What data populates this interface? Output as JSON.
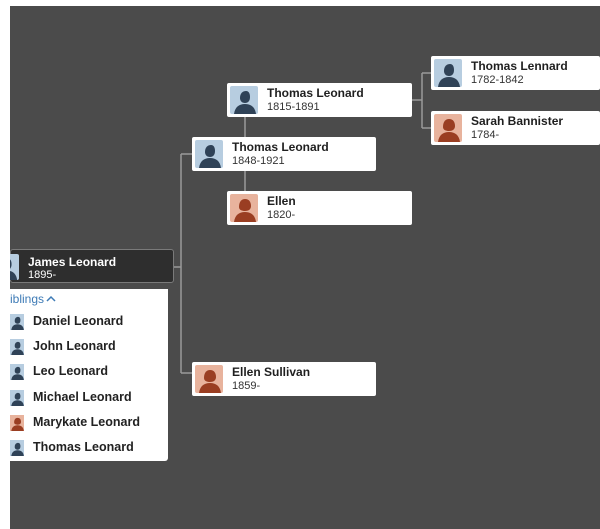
{
  "colors": {
    "canvas_bg": "#4b4b4b",
    "connector": "#9a9a9a",
    "male_bg": "#b7cde0",
    "male_fg": "#2f4257",
    "female_bg": "#e8b39d",
    "female_fg": "#9a3e22",
    "link": "#3e7bb6"
  },
  "focus": {
    "name": "James Leonard",
    "dates": "1895-",
    "gender": "male"
  },
  "parents": {
    "father": {
      "name": "Thomas Leonard",
      "dates": "1848-1921",
      "gender": "male"
    },
    "mother": {
      "name": "Ellen Sullivan",
      "dates": "1859-",
      "gender": "female"
    }
  },
  "grandparents": {
    "father": {
      "name": "Thomas Leonard",
      "dates": "1815-1891",
      "gender": "male"
    },
    "mother": {
      "name": "Ellen",
      "dates": "1820-",
      "gender": "female"
    }
  },
  "great_grandparents": {
    "father": {
      "name": "Thomas Lennard",
      "dates": "1782-1842",
      "gender": "male"
    },
    "mother": {
      "name": "Sarah Bannister",
      "dates": "1784-",
      "gender": "female"
    }
  },
  "siblings": {
    "toggle_label": "iblings",
    "toggle_icon": "chevron-up-icon",
    "items": [
      {
        "name": "Daniel Leonard",
        "gender": "male"
      },
      {
        "name": "John Leonard",
        "gender": "male"
      },
      {
        "name": "Leo Leonard",
        "gender": "male"
      },
      {
        "name": "Michael Leonard",
        "gender": "male"
      },
      {
        "name": "Marykate Leonard",
        "gender": "female"
      },
      {
        "name": "Thomas Leonard",
        "gender": "male"
      }
    ]
  }
}
